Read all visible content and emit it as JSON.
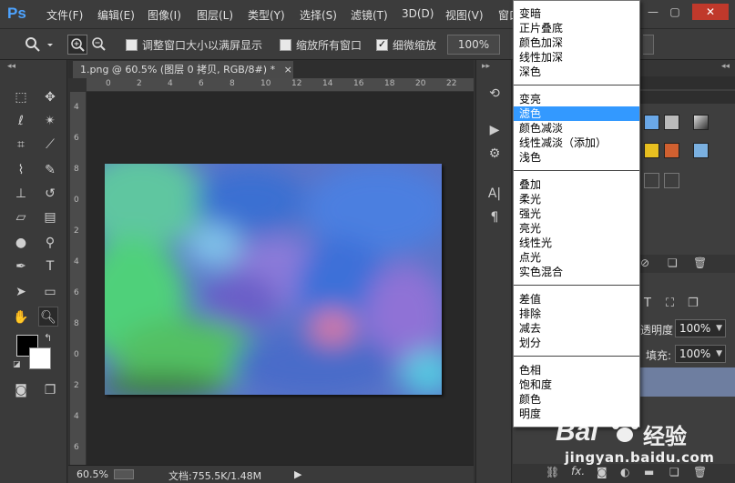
{
  "app": {
    "logo": "Ps"
  },
  "menubar": {
    "items": [
      "文件(F)",
      "编辑(E)",
      "图像(I)",
      "图层(L)",
      "类型(Y)",
      "选择(S)",
      "滤镜(T)",
      "3D(D)",
      "视图(V)",
      "窗口"
    ],
    "window_controls": [
      "—",
      "▢",
      "✕"
    ]
  },
  "options": {
    "resize_windows": "调整窗口大小以满屏显示",
    "zoom_all": "缩放所有窗口",
    "scrubby_zoom": "细微缩放",
    "zoom_value": "100%"
  },
  "document": {
    "tab_title": "1.png @ 60.5% (图层 0 拷贝, RGB/8#) *",
    "close": "×",
    "ruler_top": [
      "0",
      "2",
      "4",
      "6",
      "8",
      "10",
      "12",
      "14",
      "16",
      "18",
      "20",
      "22"
    ],
    "ruler_left": [
      "4",
      "6",
      "8",
      "0",
      "2",
      "4",
      "6",
      "8",
      "0",
      "2",
      "4",
      "6"
    ]
  },
  "status": {
    "zoom": "60.5%",
    "doc_info": "文档:755.5K/1.48M",
    "arrow": "▶"
  },
  "layers": {
    "opacity_label": "不透明度:",
    "opacity_value": "100%",
    "fill_label": "填充:",
    "fill_value": "100%"
  },
  "blend_menu": {
    "groups": [
      [
        "变暗",
        "正片叠底",
        "颜色加深",
        "线性加深",
        "深色"
      ],
      [
        "变亮",
        "滤色",
        "颜色减淡",
        "线性减淡（添加）",
        "浅色"
      ],
      [
        "叠加",
        "柔光",
        "强光",
        "亮光",
        "线性光",
        "点光",
        "实色混合"
      ],
      [
        "差值",
        "排除",
        "减去",
        "划分"
      ],
      [
        "色相",
        "饱和度",
        "颜色",
        "明度"
      ]
    ],
    "selected": "滤色"
  },
  "watermark": {
    "brand": "Bai",
    "brand2": "经验",
    "url": "jingyan.baidu.com"
  },
  "colors": {
    "accent": "#3399ff",
    "ps_blue": "#4da3ff"
  }
}
